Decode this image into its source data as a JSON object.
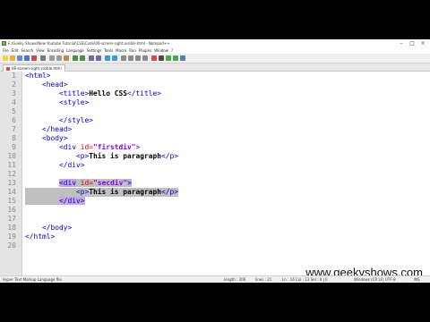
{
  "window": {
    "title": "E:\\Geeky Shows\\New Youtube Tutorial\\CSS\\Code\\06-screen-sight.visible.html - Notepad++",
    "controls": [
      "–",
      "□",
      "×"
    ]
  },
  "menu": [
    "File",
    "Edit",
    "Search",
    "View",
    "Encoding",
    "Language",
    "Settings",
    "Tools",
    "Macro",
    "Run",
    "Plugins",
    "Window",
    "?"
  ],
  "tab": {
    "label": "06-screen-sight.visible.html"
  },
  "editor": {
    "lines": [
      {
        "num": "1",
        "code": "<html>"
      },
      {
        "num": "2",
        "code": "    <head>"
      },
      {
        "num": "3",
        "code": "        <title>Hello CSS</title>"
      },
      {
        "num": "4",
        "code": "        <style>"
      },
      {
        "num": "5",
        "code": ""
      },
      {
        "num": "6",
        "code": "        </style>"
      },
      {
        "num": "7",
        "code": "    </head>"
      },
      {
        "num": "8",
        "code": "    <body>"
      },
      {
        "num": "9",
        "code": "        <div id=\"firstdiv\">"
      },
      {
        "num": "10",
        "code": "            <p>This is paragraph</p>"
      },
      {
        "num": "11",
        "code": "        </div>"
      },
      {
        "num": "12",
        "code": ""
      },
      {
        "num": "13",
        "code": "        <div id=\"secdiv\">"
      },
      {
        "num": "14",
        "code": "            <p>This is paragraph</p>"
      },
      {
        "num": "15",
        "code": "        </div>"
      },
      {
        "num": "16",
        "code": ""
      },
      {
        "num": "17",
        "code": ""
      },
      {
        "num": "18",
        "code": "    </body>"
      },
      {
        "num": "19",
        "code": "</html>"
      },
      {
        "num": "20",
        "code": ""
      }
    ]
  },
  "status": {
    "language": "Hyper Text Markup Language file",
    "length": "length : 206",
    "lines": "lines : 21",
    "position": "Ln : 16   Col : 13   Sel : 0 | 0",
    "eol": "Windows (CR LF)",
    "encoding": "UTF-8",
    "mode": "INS"
  },
  "watermark": "www.geekyshows.com",
  "colors": {
    "tag": "#0000cc",
    "attr": "#cc0000",
    "value": "#8000ff",
    "selection": "#c0c0c0"
  }
}
